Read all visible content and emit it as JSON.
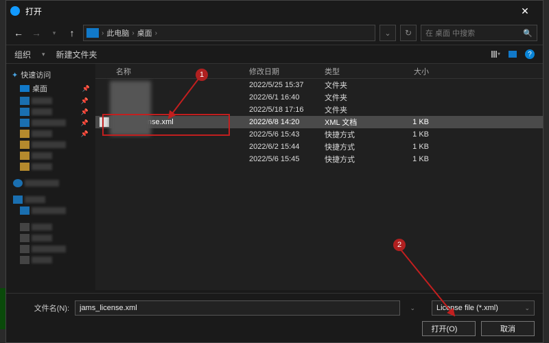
{
  "title": "打开",
  "breadcrumb": {
    "pc": "此电脑",
    "desktop": "桌面"
  },
  "search": {
    "placeholder": "在 桌面 中搜索"
  },
  "toolbar": {
    "organize": "组织",
    "newfolder": "新建文件夹"
  },
  "sidebar": {
    "quickaccess": "快速访问",
    "desktop": "桌面"
  },
  "columns": {
    "name": "名称",
    "date": "修改日期",
    "type": "类型",
    "size": "大小"
  },
  "rows": [
    {
      "name": "",
      "date": "2022/5/25 15:37",
      "type": "文件夹",
      "size": ""
    },
    {
      "name": "",
      "date": "2022/6/1 16:40",
      "type": "文件夹",
      "size": ""
    },
    {
      "name": "",
      "date": "2022/5/18 17:16",
      "type": "文件夹",
      "size": ""
    },
    {
      "name": "jams_license.xml",
      "date": "2022/6/8 14:20",
      "type": "XML 文档",
      "size": "1 KB",
      "selected": true
    },
    {
      "name": "",
      "date": "2022/5/6 15:43",
      "type": "快捷方式",
      "size": "1 KB"
    },
    {
      "name": "",
      "date": "2022/6/2 15:44",
      "type": "快捷方式",
      "size": "1 KB"
    },
    {
      "name": "",
      "date": "2022/5/6 15:45",
      "type": "快捷方式",
      "size": "1 KB"
    }
  ],
  "filename": {
    "label": "文件名(N):",
    "value": "jams_license.xml"
  },
  "filter": {
    "value": "License file (*.xml)"
  },
  "buttons": {
    "open": "打开(O)",
    "cancel": "取消"
  },
  "badges": {
    "one": "1",
    "two": "2"
  }
}
